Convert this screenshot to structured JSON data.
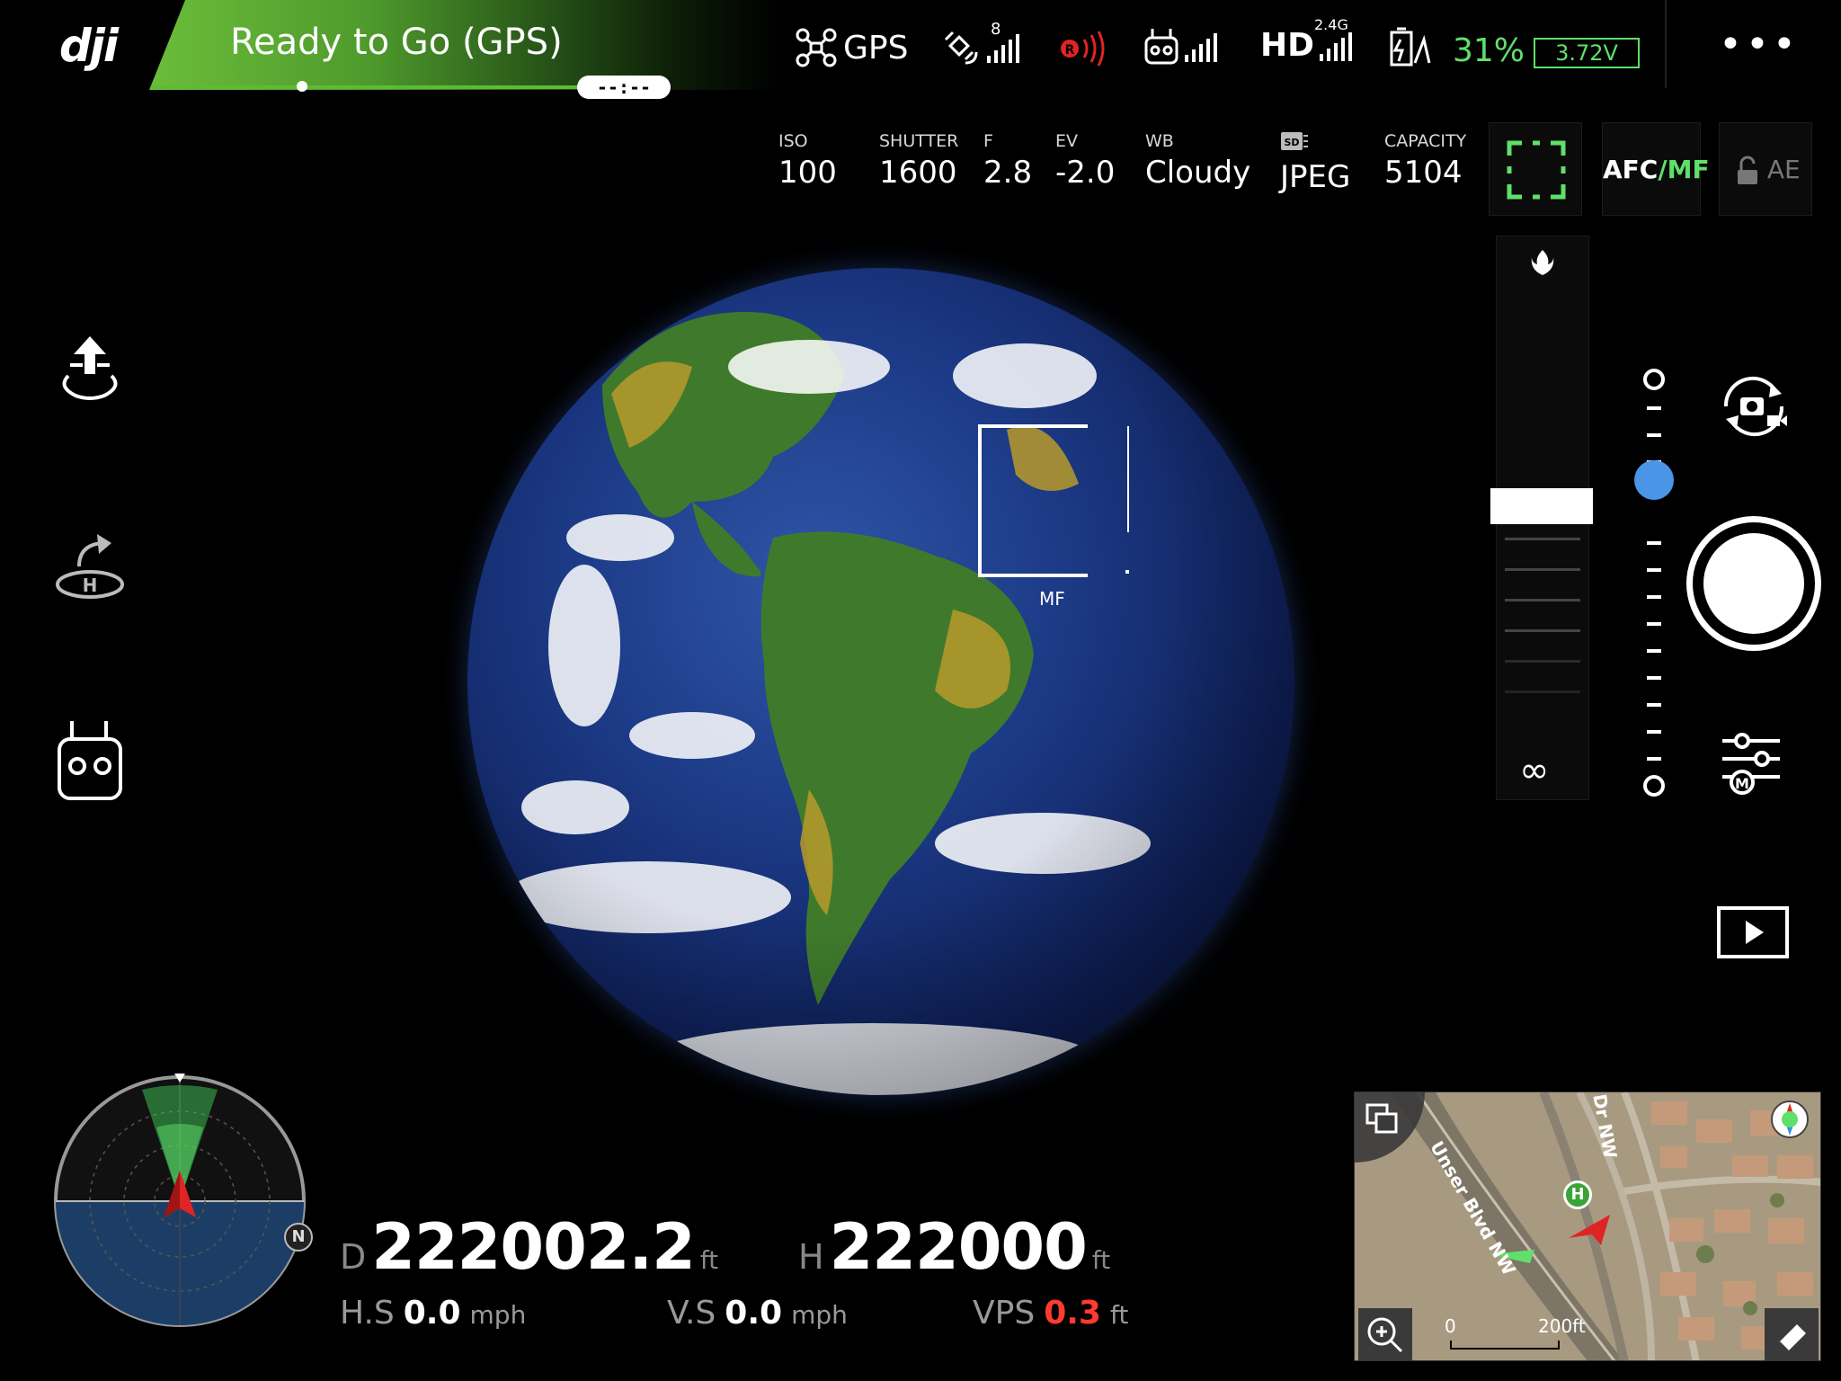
{
  "app": {
    "logo": "dji"
  },
  "status": {
    "text": "Ready to Go (GPS)",
    "flight_time": "--:--"
  },
  "telemetry_top": {
    "gps_label": "GPS",
    "satellites": "8",
    "rc_frequency": "2.4G",
    "hd_label": "HD",
    "battery_percent": "31%",
    "battery_voltage": "3.72V",
    "more_menu": "•••"
  },
  "camera": {
    "iso": {
      "label": "ISO",
      "value": "100"
    },
    "shutter": {
      "label": "SHUTTER",
      "value": "1600"
    },
    "f": {
      "label": "F",
      "value": "2.8"
    },
    "ev": {
      "label": "EV",
      "value": "-2.0"
    },
    "wb": {
      "label": "WB",
      "value": "Cloudy"
    },
    "format": {
      "value": "JPEG"
    },
    "capacity": {
      "label": "CAPACITY",
      "value": "5104"
    },
    "afc": "AFC",
    "mf": "MF",
    "ae": "AE"
  },
  "focus": {
    "mf_label": "MF",
    "infinity": "∞"
  },
  "flight": {
    "d_label": "D",
    "d_value": "222002.2",
    "d_unit": "ft",
    "h_label": "H",
    "h_value": "222000",
    "h_unit": "ft",
    "hs_label": "H.S",
    "hs_value": "0.0",
    "hs_unit": "mph",
    "vs_label": "V.S",
    "vs_value": "0.0",
    "vs_unit": "mph",
    "vps_label": "VPS",
    "vps_value": "0.3",
    "vps_unit": "ft"
  },
  "compass": {
    "north": "N"
  },
  "map": {
    "street1": "Unser Blvd NW",
    "street2": "Dr NW",
    "scale_start": "0",
    "scale_end": "200ft",
    "home_marker": "H"
  },
  "colors": {
    "accent_green": "#5fe06a",
    "vps_red": "#ff3b30",
    "slider_blue": "#4a95e6"
  }
}
